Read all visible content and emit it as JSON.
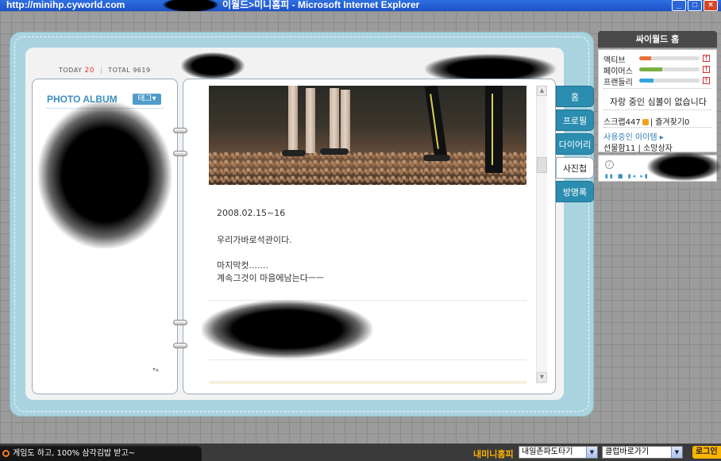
{
  "window": {
    "url": "http://minihp.cyworld.com",
    "title_suffix": "이월드>미니홈피 - Microsoft Internet Explorer",
    "buttons": [
      "_",
      "□",
      "×"
    ]
  },
  "counter": {
    "today_label": "TODAY",
    "today_value": "20",
    "total_label": "TOTAL",
    "total_value": "9619"
  },
  "album": {
    "title": "PHOTO ALBUM",
    "tag_button": "태그▾",
    "arrows": "▾▴"
  },
  "post": {
    "date": "2008.02.15~16",
    "line1": "우리가바로석관이다.",
    "line2": "마지막컷.......",
    "line3": "계속그것이 마음에남는다ㅡㅡ"
  },
  "tabs": [
    {
      "label": "홈"
    },
    {
      "label": "프로필"
    },
    {
      "label": "다이어리"
    },
    {
      "label": "사진첩"
    },
    {
      "label": "방명록"
    }
  ],
  "side": {
    "header": "싸이월드 홈",
    "stats": [
      {
        "label": "액티브",
        "level": 0.2,
        "color": "#e8703a"
      },
      {
        "label": "페이머스",
        "level": 0.38,
        "color": "#78b040"
      },
      {
        "label": "프랜들리",
        "level": 0.24,
        "color": "#2fa6d8"
      }
    ],
    "arrow": "↑",
    "empty_msg": "자랑 중인 심볼이 없습니다",
    "scrap_label": "스크랩447",
    "favorite_label": "| 즐겨찾기0",
    "items_link": "사용중인 아이템 ▸",
    "gift_label": "선물함11",
    "wish_label": "| 소망상자",
    "player_controls": "▮▮ ■ ▮◂ ▸▮"
  },
  "status": {
    "message": "게임도 하고, 100% 삼각김밥 받고~",
    "my_minihp": "내미니홈피",
    "select1": "내일촌파도타기",
    "select2": "클럽바로가기",
    "login": "로그인"
  }
}
